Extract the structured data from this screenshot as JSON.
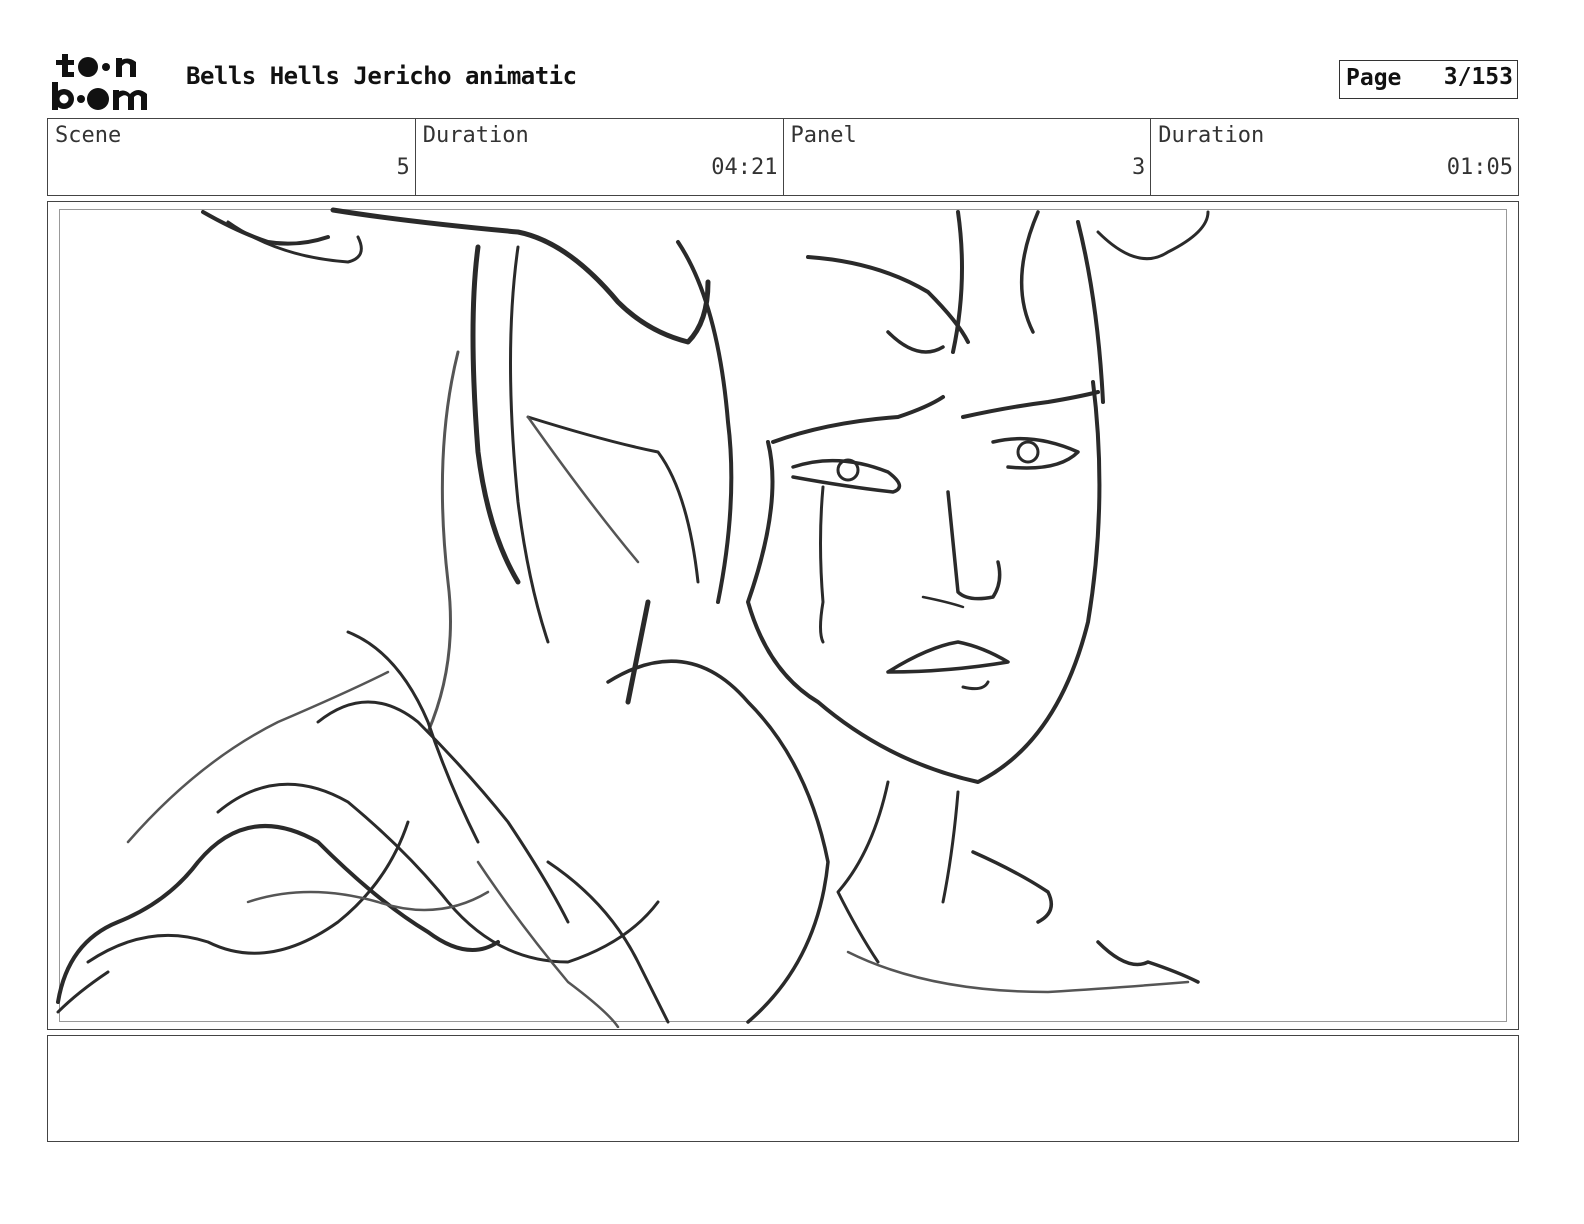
{
  "header": {
    "logo": {
      "top": "toon",
      "bottom": "boom"
    },
    "title": "Bells Hells Jericho animatic",
    "page_label": "Page",
    "page_value": "3/153"
  },
  "info": {
    "scene_label": "Scene",
    "scene_value": "5",
    "scene_duration_label": "Duration",
    "scene_duration_value": "04:21",
    "panel_label": "Panel",
    "panel_value": "3",
    "panel_duration_label": "Duration",
    "panel_duration_value": "01:05"
  },
  "panel_image": {
    "icon": "sketch-drawing"
  },
  "notes": {
    "text": ""
  }
}
